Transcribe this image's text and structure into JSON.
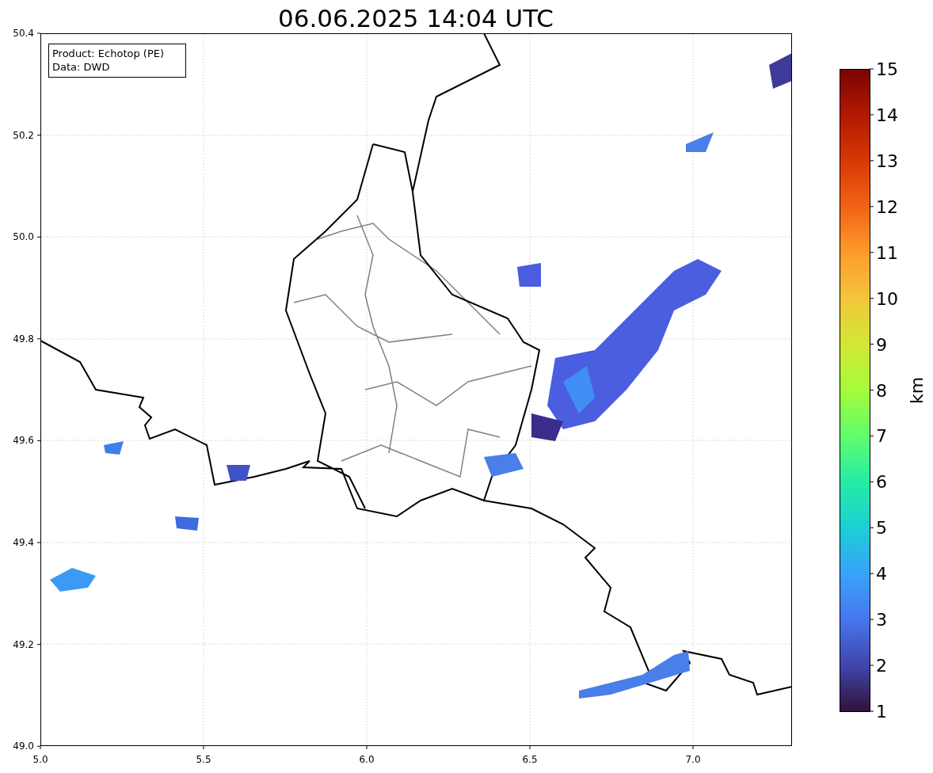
{
  "figure": {
    "title": "06.06.2025 14:04 UTC",
    "legend": [
      "Product: Echotop (PE)",
      "Data: DWD"
    ],
    "x_ticks": [
      "5.0",
      "5.5",
      "6.0",
      "6.5",
      "7.0"
    ],
    "y_ticks": [
      "50.4",
      "50.2",
      "50.0",
      "49.8",
      "49.6",
      "49.4",
      "49.2",
      "49.0"
    ],
    "colorbar": {
      "label": "km",
      "ticks": [
        "15",
        "14",
        "13",
        "12",
        "11",
        "10",
        "9",
        "8",
        "7",
        "6",
        "5",
        "4",
        "3",
        "2",
        "1"
      ]
    }
  }
}
